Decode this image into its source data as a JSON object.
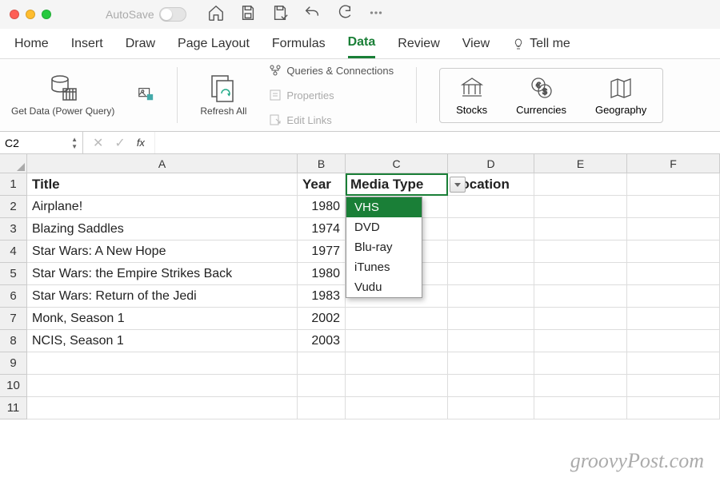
{
  "titlebar": {
    "autosave": "AutoSave"
  },
  "tabs": [
    "Home",
    "Insert",
    "Draw",
    "Page Layout",
    "Formulas",
    "Data",
    "Review",
    "View"
  ],
  "active_tab": "Data",
  "tellme": "Tell me",
  "ribbon": {
    "getdata": "Get Data (Power Query)",
    "refresh": "Refresh All",
    "queries": "Queries & Connections",
    "properties": "Properties",
    "editlinks": "Edit Links",
    "stocks": "Stocks",
    "currencies": "Currencies",
    "geography": "Geography"
  },
  "namebox": "C2",
  "columns": [
    "A",
    "B",
    "C",
    "D",
    "E",
    "F"
  ],
  "headers": {
    "title": "Title",
    "year": "Year",
    "media": "Media Type",
    "location": "Location"
  },
  "rows": [
    {
      "n": 1
    },
    {
      "n": 2,
      "title": "Airplane!",
      "year": "1980"
    },
    {
      "n": 3,
      "title": "Blazing Saddles",
      "year": "1974"
    },
    {
      "n": 4,
      "title": "Star Wars: A New Hope",
      "year": "1977"
    },
    {
      "n": 5,
      "title": "Star Wars: the Empire Strikes Back",
      "year": "1980"
    },
    {
      "n": 6,
      "title": "Star Wars: Return of the Jedi",
      "year": "1983"
    },
    {
      "n": 7,
      "title": "Monk, Season 1",
      "year": "2002"
    },
    {
      "n": 8,
      "title": "NCIS, Season 1",
      "year": "2003"
    },
    {
      "n": 9
    },
    {
      "n": 10
    },
    {
      "n": 11
    }
  ],
  "dropdown": {
    "selected": "VHS",
    "options": [
      "VHS",
      "DVD",
      "Blu-ray",
      "iTunes",
      "Vudu"
    ]
  },
  "watermark": "groovyPost.com"
}
